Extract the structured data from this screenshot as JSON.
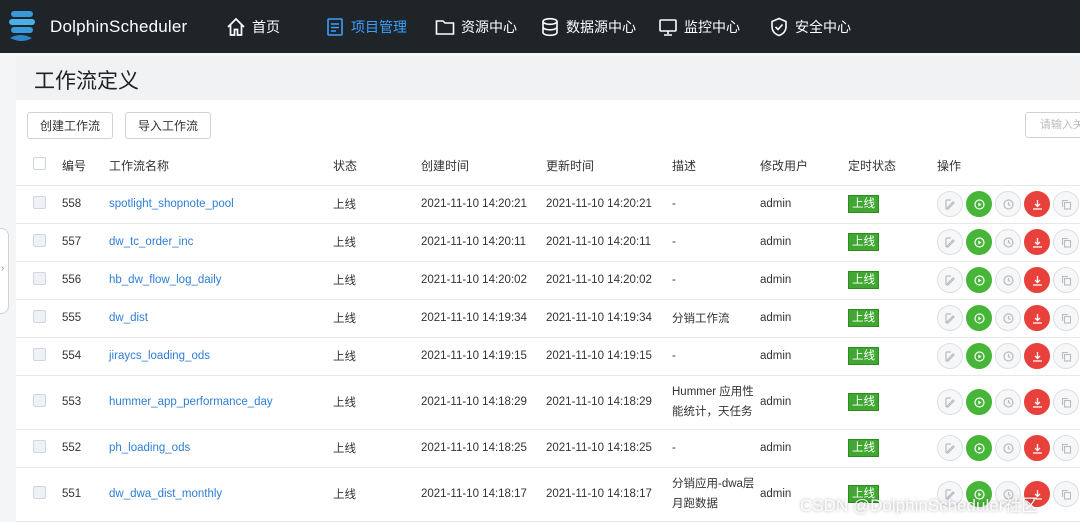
{
  "app": {
    "name": "DolphinScheduler"
  },
  "nav": [
    {
      "label": "首页",
      "icon": "home-icon"
    },
    {
      "label": "项目管理",
      "icon": "project-icon",
      "active": true
    },
    {
      "label": "资源中心",
      "icon": "folder-icon"
    },
    {
      "label": "数据源中心",
      "icon": "database-icon"
    },
    {
      "label": "监控中心",
      "icon": "monitor-icon"
    },
    {
      "label": "安全中心",
      "icon": "shield-icon"
    }
  ],
  "page": {
    "title": "工作流定义",
    "create_label": "创建工作流",
    "import_label": "导入工作流",
    "search_placeholder": "请输入关键词"
  },
  "table": {
    "headers": [
      "编号",
      "工作流名称",
      "状态",
      "创建时间",
      "更新时间",
      "描述",
      "修改用户",
      "定时状态",
      "操作"
    ],
    "rows": [
      {
        "id": "558",
        "name": "spotlight_shopnote_pool",
        "status": "上线",
        "created": "2021-11-10 14:20:21",
        "updated": "2021-11-10 14:20:21",
        "desc": "-",
        "user": "admin",
        "timing": "上线"
      },
      {
        "id": "557",
        "name": "dw_tc_order_inc",
        "status": "上线",
        "created": "2021-11-10 14:20:11",
        "updated": "2021-11-10 14:20:11",
        "desc": "-",
        "user": "admin",
        "timing": "上线"
      },
      {
        "id": "556",
        "name": "hb_dw_flow_log_daily",
        "status": "上线",
        "created": "2021-11-10 14:20:02",
        "updated": "2021-11-10 14:20:02",
        "desc": "-",
        "user": "admin",
        "timing": "上线"
      },
      {
        "id": "555",
        "name": "dw_dist",
        "status": "上线",
        "created": "2021-11-10 14:19:34",
        "updated": "2021-11-10 14:19:34",
        "desc": "分销工作流",
        "user": "admin",
        "timing": "上线"
      },
      {
        "id": "554",
        "name": "jiraycs_loading_ods",
        "status": "上线",
        "created": "2021-11-10 14:19:15",
        "updated": "2021-11-10 14:19:15",
        "desc": "-",
        "user": "admin",
        "timing": "上线"
      },
      {
        "id": "553",
        "name": "hummer_app_performance_day",
        "status": "上线",
        "created": "2021-11-10 14:18:29",
        "updated": "2021-11-10 14:18:29",
        "desc": "Hummer 应用性能统计，天任务",
        "user": "admin",
        "timing": "上线"
      },
      {
        "id": "552",
        "name": "ph_loading_ods",
        "status": "上线",
        "created": "2021-11-10 14:18:25",
        "updated": "2021-11-10 14:18:25",
        "desc": "-",
        "user": "admin",
        "timing": "上线"
      },
      {
        "id": "551",
        "name": "dw_dwa_dist_monthly",
        "status": "上线",
        "created": "2021-11-10 14:18:17",
        "updated": "2021-11-10 14:18:17",
        "desc": "分销应用-dwa层月跑数据",
        "user": "admin",
        "timing": "上线"
      }
    ]
  },
  "colors": {
    "topbar": "#1f2428",
    "accent": "#3aa0ff",
    "online_tag": "#40a832",
    "run_button": "#47b638",
    "download_button": "#e8403b"
  },
  "watermark": "CSDN @DolphinScheduler社区"
}
